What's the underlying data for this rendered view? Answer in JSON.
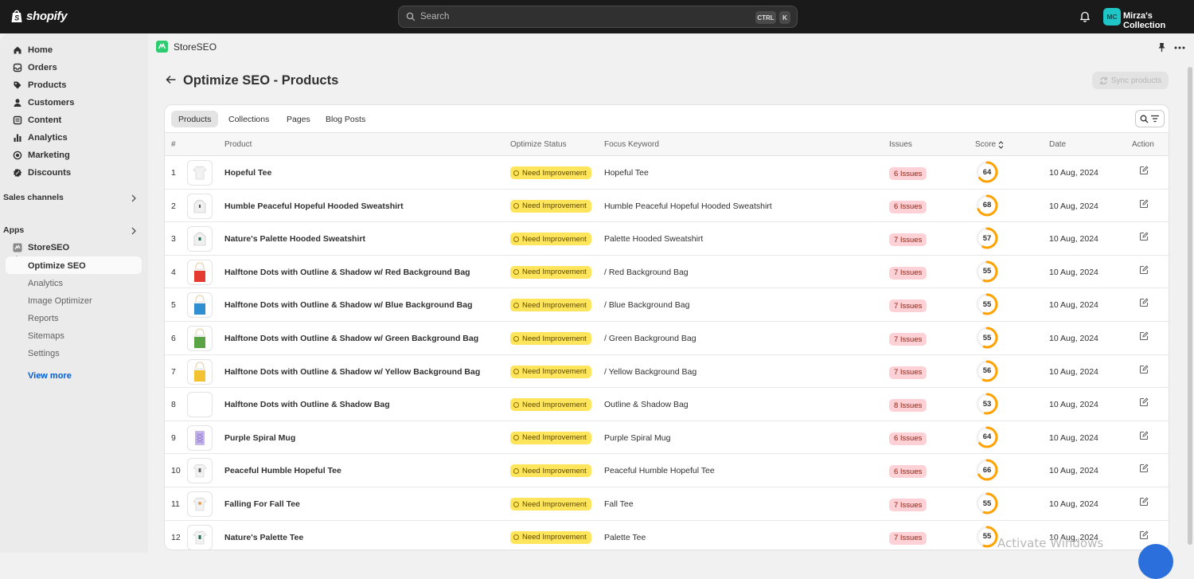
{
  "topbar": {
    "logo_text": "shopify",
    "search_placeholder": "Search",
    "kbd_ctrl": "CTRL",
    "kbd_k": "K",
    "store_initials": "MC",
    "store_name": "Mirza's Collection"
  },
  "sidebar": {
    "items": [
      {
        "label": "Home",
        "icon": "home-icon"
      },
      {
        "label": "Orders",
        "icon": "inbox-icon"
      },
      {
        "label": "Products",
        "icon": "tag-icon"
      },
      {
        "label": "Customers",
        "icon": "person-icon"
      },
      {
        "label": "Content",
        "icon": "content-icon"
      },
      {
        "label": "Analytics",
        "icon": "bar-chart-icon"
      },
      {
        "label": "Marketing",
        "icon": "target-icon"
      },
      {
        "label": "Discounts",
        "icon": "discount-icon"
      }
    ],
    "sales_channels": "Sales channels",
    "apps": "Apps",
    "app_name": "StoreSEO",
    "app_subitems": [
      "Optimize SEO",
      "Analytics",
      "Image Optimizer",
      "Reports",
      "Sitemaps",
      "Settings"
    ],
    "view_more": "View more"
  },
  "app_header": {
    "name": "StoreSEO"
  },
  "page": {
    "title": "Optimize SEO - Products",
    "sync_button": "Sync products"
  },
  "tabs": [
    "Products",
    "Collections",
    "Pages",
    "Blog Posts"
  ],
  "table": {
    "headers": {
      "num": "#",
      "product": "Product",
      "status": "Optimize Status",
      "keyword": "Focus Keyword",
      "issues": "Issues",
      "score": "Score",
      "date": "Date",
      "action": "Action"
    },
    "rows": [
      {
        "num": "1",
        "product": "Hopeful Tee",
        "status": "Need Improvement",
        "keyword": "Hopeful Tee",
        "issues": "6 Issues",
        "score": 64,
        "date": "10 Aug, 2024",
        "thumb": "white-tee"
      },
      {
        "num": "2",
        "product": "Humble Peaceful Hopeful Hooded Sweatshirt",
        "status": "Need Improvement",
        "keyword": "Humble Peaceful Hopeful Hooded Sweatshirt",
        "issues": "6 Issues",
        "score": 68,
        "date": "10 Aug, 2024",
        "thumb": "white-hoodie"
      },
      {
        "num": "3",
        "product": "Nature's Palette Hooded Sweatshirt",
        "status": "Need Improvement",
        "keyword": "Palette Hooded Sweatshirt",
        "issues": "7 Issues",
        "score": 57,
        "date": "10 Aug, 2024",
        "thumb": "white-hoodie-green"
      },
      {
        "num": "4",
        "product": "Halftone Dots with Outline & Shadow w/ Red Background Bag",
        "status": "Need Improvement",
        "keyword": "/ Red Background Bag",
        "issues": "7 Issues",
        "score": 55,
        "date": "10 Aug, 2024",
        "thumb": "red-bag"
      },
      {
        "num": "5",
        "product": "Halftone Dots with Outline & Shadow w/ Blue Background Bag",
        "status": "Need Improvement",
        "keyword": "/ Blue Background Bag",
        "issues": "7 Issues",
        "score": 55,
        "date": "10 Aug, 2024",
        "thumb": "blue-bag"
      },
      {
        "num": "6",
        "product": "Halftone Dots with Outline & Shadow w/ Green Background Bag",
        "status": "Need Improvement",
        "keyword": "/ Green Background Bag",
        "issues": "7 Issues",
        "score": 55,
        "date": "10 Aug, 2024",
        "thumb": "green-bag"
      },
      {
        "num": "7",
        "product": "Halftone Dots with Outline & Shadow w/ Yellow Background Bag",
        "status": "Need Improvement",
        "keyword": "/ Yellow Background Bag",
        "issues": "7 Issues",
        "score": 56,
        "date": "10 Aug, 2024",
        "thumb": "yellow-bag"
      },
      {
        "num": "8",
        "product": "Halftone Dots with Outline & Shadow Bag",
        "status": "Need Improvement",
        "keyword": "Outline & Shadow Bag",
        "issues": "8 Issues",
        "score": 53,
        "date": "10 Aug, 2024",
        "thumb": "blank"
      },
      {
        "num": "9",
        "product": "Purple Spiral Mug",
        "status": "Need Improvement",
        "keyword": "Purple Spiral Mug",
        "issues": "6 Issues",
        "score": 64,
        "date": "10 Aug, 2024",
        "thumb": "purple-mug"
      },
      {
        "num": "10",
        "product": "Peaceful Humble Hopeful Tee",
        "status": "Need Improvement",
        "keyword": "Peaceful Humble Hopeful Tee",
        "issues": "6 Issues",
        "score": 66,
        "date": "10 Aug, 2024",
        "thumb": "white-tee-print"
      },
      {
        "num": "11",
        "product": "Falling For Fall Tee",
        "status": "Need Improvement",
        "keyword": "Fall Tee",
        "issues": "7 Issues",
        "score": 55,
        "date": "10 Aug, 2024",
        "thumb": "white-tee-fall"
      },
      {
        "num": "12",
        "product": "Nature's Palette Tee",
        "status": "Need Improvement",
        "keyword": "Palette Tee",
        "issues": "7 Issues",
        "score": 55,
        "date": "10 Aug, 2024",
        "thumb": "white-tee-green"
      }
    ]
  },
  "watermark": "Activate Windows",
  "colors": {
    "score_ring": "#ffa200",
    "status_bg": "#ffe55c",
    "issues_bg": "#fed1d7",
    "link": "#005bd3"
  }
}
